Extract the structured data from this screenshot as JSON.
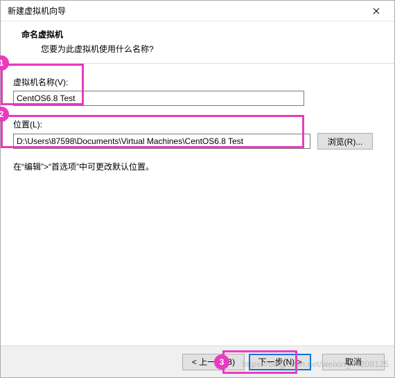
{
  "window": {
    "title": "新建虚拟机向导"
  },
  "header": {
    "title": "命名虚拟机",
    "subtitle": "您要为此虚拟机使用什么名称?"
  },
  "fields": {
    "name_label": "虚拟机名称(V):",
    "name_value": "CentOS6.8 Test",
    "location_label": "位置(L):",
    "location_value": "D:\\Users\\87598\\Documents\\Virtual Machines\\CentOS6.8 Test",
    "browse_label": "浏览(R)...",
    "hint": "在“编辑”>“首选项”中可更改默认位置。"
  },
  "buttons": {
    "back": "< 上一步(B)",
    "next": "下一步(N) >",
    "cancel": "取消"
  },
  "annotations": {
    "one": "1",
    "two": "2",
    "three": "3"
  },
  "watermark": "https://blog.csdn.net/weixin_44208125"
}
